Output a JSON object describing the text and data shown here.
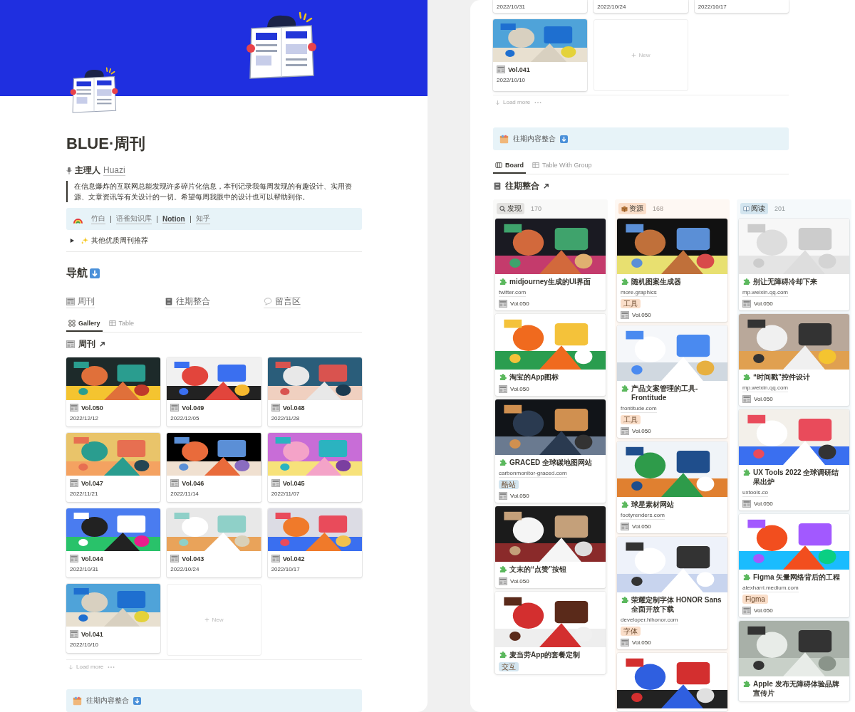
{
  "left_page": {
    "title": "BLUE·周刊",
    "owner": {
      "label": "主理人",
      "name": "Huazi"
    },
    "quote": "在信息爆炸的互联网总能发现许多碎片化信息，本刊记录我每周发现的有趣设计、实用资源、文章资讯等有关设计的一切。希望每周我眼中的设计也可以帮助到你。",
    "links": [
      "竹白",
      "语雀知识库",
      "Notion",
      "知乎"
    ],
    "toggle": {
      "label": "其他优质周刊推荐",
      "expanded": false
    },
    "nav_heading": "导航",
    "nav_links": [
      {
        "label": "周刊"
      },
      {
        "label": "往期整合"
      },
      {
        "label": "留言区"
      }
    ],
    "view_tabs": [
      {
        "label": "Gallery",
        "selected": true
      },
      {
        "label": "Table",
        "selected": false
      }
    ],
    "database_title": "周刊",
    "gallery": [
      {
        "title": "Vol.050",
        "date": "2022/12/12"
      },
      {
        "title": "Vol.049",
        "date": "2022/12/05"
      },
      {
        "title": "Vol.048",
        "date": "2022/11/28"
      },
      {
        "title": "Vol.047",
        "date": "2022/11/21"
      },
      {
        "title": "Vol.046",
        "date": "2022/11/14"
      },
      {
        "title": "Vol.045",
        "date": "2022/11/07"
      },
      {
        "title": "Vol.044",
        "date": "2022/10/31"
      },
      {
        "title": "Vol.043",
        "date": "2022/10/24"
      },
      {
        "title": "Vol.042",
        "date": "2022/10/17"
      },
      {
        "title": "Vol.041",
        "date": "2022/10/10"
      }
    ],
    "new_card": "New",
    "load_more": "Load more",
    "callout": "往期内容整合"
  },
  "right_page": {
    "cut_dates": [
      "2022/10/31",
      "2022/10/24",
      "2022/10/17"
    ],
    "gallery": [
      {
        "title": "Vol.041",
        "date": "2022/10/10"
      }
    ],
    "new_card": "New",
    "load_more": "Load more",
    "callout": "往期内容整合",
    "view_tabs": [
      {
        "label": "Board",
        "selected": true
      },
      {
        "label": "Table With Group",
        "selected": false
      }
    ],
    "database_title": "往期整合",
    "groups": [
      {
        "label": "发现",
        "count": "170",
        "color": "#e3e2e0",
        "cards": [
          {
            "title": "midjourney生成的UI界面",
            "domain": "twitter.com",
            "vol": "Vol.050"
          },
          {
            "title": "淘宝的App图标",
            "vol": "Vol.050"
          },
          {
            "title": "GRACED 全球碳地图网站",
            "domain": "carbonmonitor-graced.com",
            "tag": {
              "label": "酷站",
              "color": "#d3e5ef"
            },
            "vol": "Vol.050"
          },
          {
            "title": "文末的“点赞”按钮",
            "vol": "Vol.050"
          },
          {
            "title": "麦当劳App的套餐定制",
            "tag": {
              "label": "交互",
              "color": "#d3e5ef"
            }
          }
        ]
      },
      {
        "label": "资源",
        "count": "168",
        "color": "#fadec9",
        "cards": [
          {
            "title": "随机图案生成器",
            "domain": "more.graphics",
            "tag": {
              "label": "工具",
              "color": "#fadec9"
            },
            "vol": "Vol.050"
          },
          {
            "title": "产品文案管理的工具-Frontitude",
            "domain": "frontitude.com",
            "tag": {
              "label": "工具",
              "color": "#fadec9"
            },
            "vol": "Vol.050"
          },
          {
            "title": "球星素材网站",
            "domain": "footyrenders.com",
            "vol": "Vol.050"
          },
          {
            "title": "荣耀定制字体 HONOR Sans 全面开放下载",
            "domain": "developer.hihonor.com",
            "tag": {
              "label": "字体",
              "color": "#fadec9"
            },
            "vol": "Vol.050"
          },
          {
            "kind": "picture"
          }
        ]
      },
      {
        "label": "阅读",
        "count": "201",
        "color": "#d3e5ef",
        "cards": [
          {
            "title": "别让无障碍冷却下来",
            "domain": "mp.weixin.qq.com",
            "vol": "Vol.050"
          },
          {
            "title": "“时间戳”控件设计",
            "domain": "mp.weixin.qq.com",
            "vol": "Vol.050"
          },
          {
            "title": "UX Tools 2022 全球调研结果出炉",
            "domain": "uxtools.co",
            "vol": "Vol.050"
          },
          {
            "title": "Figma 矢量网络背后的工程",
            "domain": "alexharri.medium.com",
            "tag": {
              "label": "Figma",
              "color": "#fadec9"
            },
            "vol": "Vol.050"
          },
          {
            "title": "Apple 发布无障碍体验品牌宣传片"
          }
        ]
      }
    ]
  }
}
